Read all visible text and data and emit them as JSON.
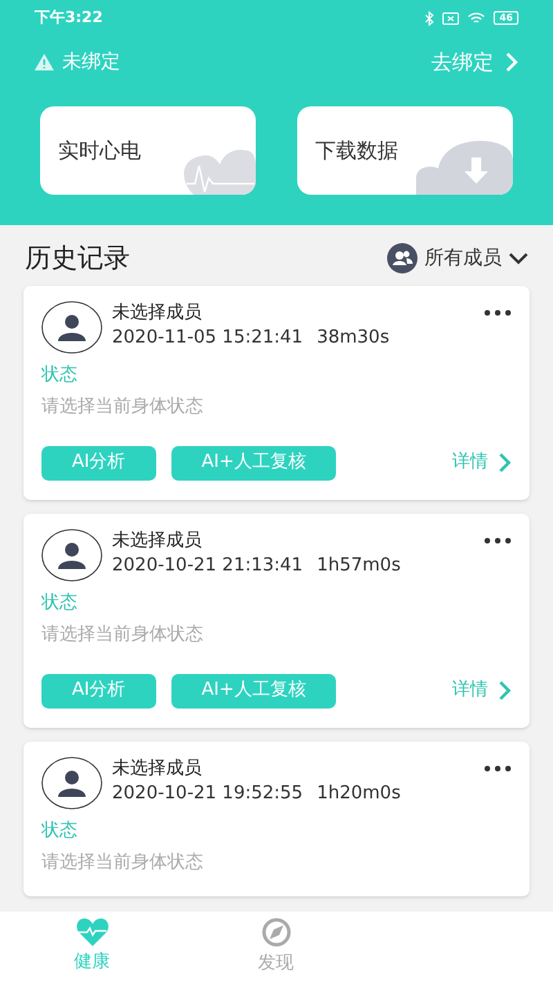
{
  "status_bar": {
    "time": "下午3:22",
    "battery": "46"
  },
  "header": {
    "bind_status": "未绑定",
    "bind_link": "去绑定"
  },
  "quick_actions": [
    {
      "kind": "ecg",
      "label": "实时心电"
    },
    {
      "kind": "download",
      "label": "下载数据"
    }
  ],
  "history": {
    "title": "历史记录",
    "filter": "所有成员",
    "records": [
      {
        "member": "未选择成员",
        "datetime": "2020-11-05 15:21:41",
        "duration": "38m30s",
        "status_label": "状态",
        "status_hint": "请选择当前身体状态",
        "actions": [
          "AI分析",
          "AI+人工复核"
        ],
        "details": "详情"
      },
      {
        "member": "未选择成员",
        "datetime": "2020-10-21 21:13:41",
        "duration": "1h57m0s",
        "status_label": "状态",
        "status_hint": "请选择当前身体状态",
        "actions": [
          "AI分析",
          "AI+人工复核"
        ],
        "details": "详情"
      },
      {
        "member": "未选择成员",
        "datetime": "2020-10-21 19:52:55",
        "duration": "1h20m0s",
        "status_label": "状态",
        "status_hint": "请选择当前身体状态"
      }
    ]
  },
  "bottom_nav": [
    {
      "kind": "health",
      "label": "健康",
      "selected": true
    },
    {
      "kind": "discover",
      "label": "发现",
      "selected": false
    }
  ]
}
